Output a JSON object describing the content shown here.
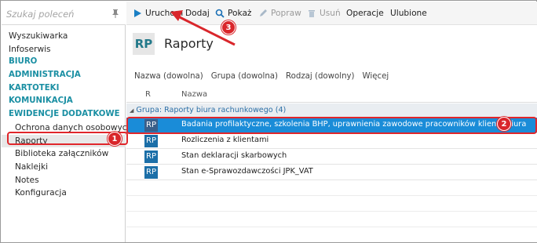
{
  "search": {
    "placeholder": "Szukaj poleceń"
  },
  "sidebar": {
    "items": [
      {
        "label": "Wyszukiwarka",
        "kind": "item"
      },
      {
        "label": "Infoserwis",
        "kind": "item"
      },
      {
        "label": "BIURO",
        "kind": "section"
      },
      {
        "label": "ADMINISTRACJA",
        "kind": "section"
      },
      {
        "label": "KARTOTEKI",
        "kind": "section"
      },
      {
        "label": "KOMUNIKACJA",
        "kind": "section"
      },
      {
        "label": "EWIDENCJE DODATKOWE",
        "kind": "section"
      },
      {
        "label": "Ochrona danych osobowych",
        "kind": "sub"
      },
      {
        "label": "Raporty",
        "kind": "sub",
        "selected": true
      },
      {
        "label": "Biblioteka załączników",
        "kind": "sub"
      },
      {
        "label": "Naklejki",
        "kind": "sub"
      },
      {
        "label": "Notes",
        "kind": "sub"
      },
      {
        "label": "Konfiguracja",
        "kind": "sub"
      }
    ]
  },
  "toolbar": {
    "run": "Uruchom",
    "add": "Dodaj",
    "show": "Pokaż",
    "edit": "Popraw",
    "delete": "Usuń",
    "operations": "Operacje",
    "favorites": "Ulubione"
  },
  "page": {
    "badge": "RP",
    "title": "Raporty"
  },
  "filters": [
    "Nazwa (dowolna)",
    "Grupa (dowolna)",
    "Rodzaj (dowolny)",
    "Więcej"
  ],
  "grid": {
    "columns": {
      "r": "R",
      "name": "Nazwa"
    },
    "group": "Grupa: Raporty biura rachunkowego (4)",
    "rows": [
      {
        "icon": "RP",
        "name": "Badania profilaktyczne, szkolenia BHP, uprawnienia zawodowe pracowników klienta biura",
        "selected": true
      },
      {
        "icon": "RP",
        "name": "Rozliczenia z klientami"
      },
      {
        "icon": "RP",
        "name": "Stan deklaracji skarbowych"
      },
      {
        "icon": "RP",
        "name": "Stan e-Sprawozdawczości JPK_VAT"
      }
    ]
  },
  "annotations": {
    "one": "1",
    "two": "2",
    "three": "3",
    "color": "#d9262b"
  },
  "colors": {
    "accent": "#1a8fa3",
    "selection": "#1a8cd8",
    "icon": "#1c6fa8"
  }
}
